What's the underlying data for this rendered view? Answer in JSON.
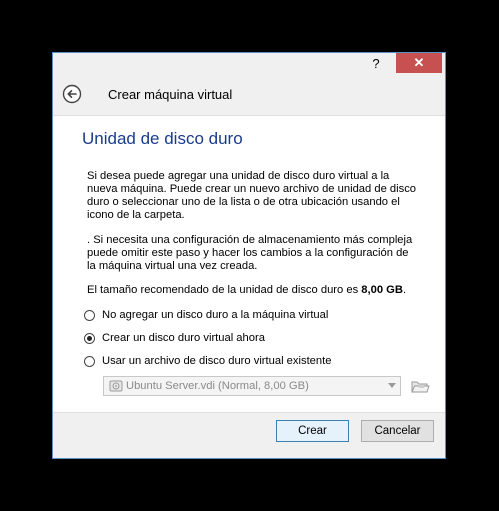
{
  "titlebar": {
    "help_label": "?",
    "close_label": "✕"
  },
  "wizard": {
    "title": "Crear máquina virtual"
  },
  "section": {
    "title": "Unidad de disco duro"
  },
  "text": {
    "p1": "Si desea puede agregar una unidad de disco duro virtual a la nueva máquina. Puede crear un nuevo archivo de unidad de disco duro o seleccionar uno de la lista o de otra ubicación usando el icono de la carpeta.",
    "p2": ". Si necesita una configuración de almacenamiento más compleja puede omitir este paso y hacer los cambios a la configuración de la máquina virtual una vez creada.",
    "p3_prefix": "El tamaño recomendado de la unidad de disco duro es ",
    "p3_value": "8,00 GB",
    "p3_suffix": "."
  },
  "options": [
    {
      "label": "No agregar un disco duro a la máquina virtual",
      "checked": false
    },
    {
      "label": "Crear un disco duro virtual ahora",
      "checked": true
    },
    {
      "label": "Usar un archivo de disco duro virtual existente",
      "checked": false
    }
  ],
  "existing_disk": {
    "selected": "Ubuntu Server.vdi (Normal, 8,00 GB)",
    "enabled": false
  },
  "buttons": {
    "create": "Crear",
    "cancel": "Cancelar"
  },
  "colors": {
    "close_button": "#c75050",
    "title_text": "#1a3b8c",
    "default_button_border": "#3c7fb1"
  },
  "icons": {
    "back": "back-arrow-icon",
    "disk": "hard-disk-icon",
    "folder": "folder-open-icon"
  }
}
